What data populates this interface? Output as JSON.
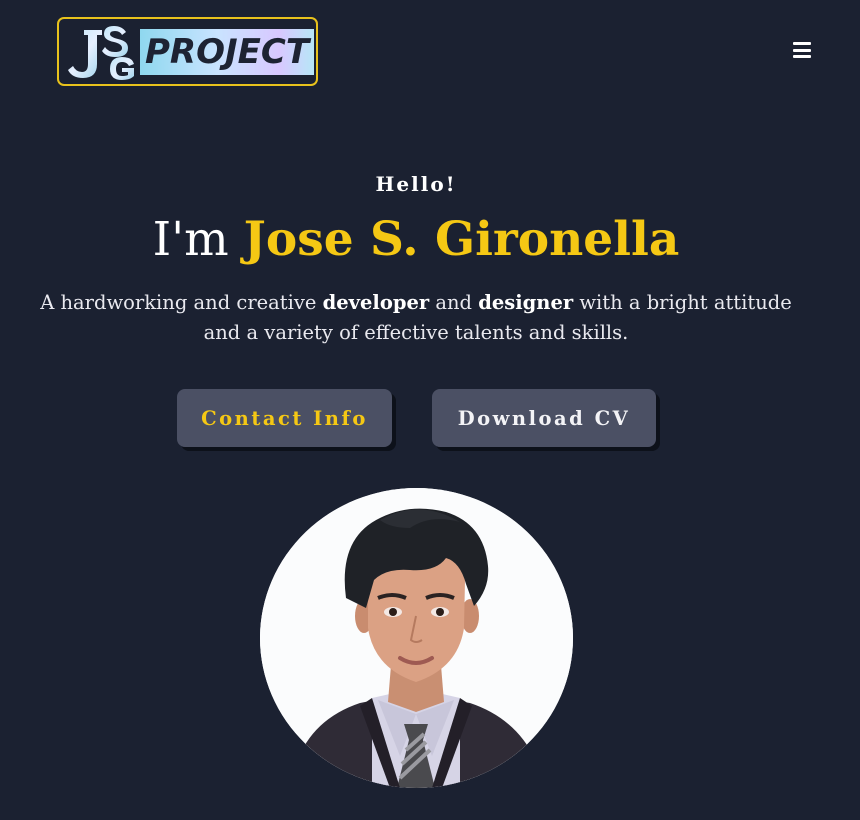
{
  "header": {
    "logo_letters": "JSG",
    "logo_word": "PROJECT",
    "menu_icon": "hamburger-icon"
  },
  "hero": {
    "greeting": "Hello!",
    "prefix": "I'm ",
    "name": "Jose S. Gironella",
    "tagline_1": "A hardworking and creative ",
    "tagline_bold_1": "developer",
    "tagline_2": " and ",
    "tagline_bold_2": "designer",
    "tagline_3": " with a bright attitude and a variety of effective talents and skills.",
    "contact_button": "Contact Info",
    "cv_button": "Download CV"
  },
  "colors": {
    "background": "#1b2131",
    "accent": "#f5c814",
    "button": "#4b5064"
  }
}
